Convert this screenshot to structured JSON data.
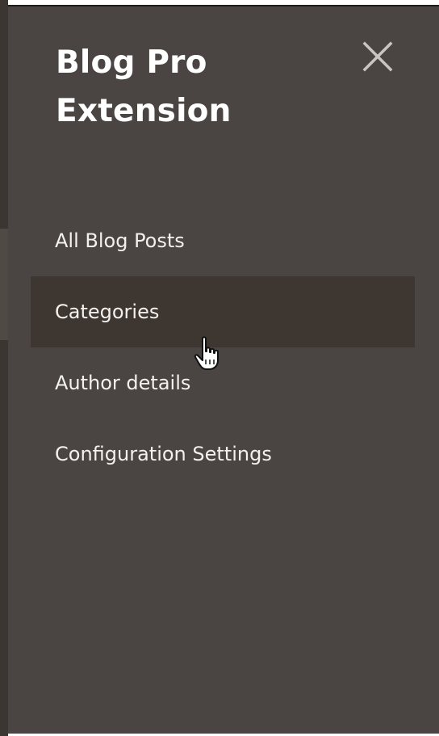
{
  "panel": {
    "title_line1": "Blog Pro",
    "title_line2": "Extension",
    "close_icon": "close-icon"
  },
  "menu": {
    "items": [
      {
        "label": "All Blog Posts",
        "active": false
      },
      {
        "label": "Categories",
        "active": true
      },
      {
        "label": "Author details",
        "active": false
      },
      {
        "label": "Configuration Settings",
        "active": false
      }
    ]
  },
  "colors": {
    "panel_bg": "#4a4542",
    "active_item_bg": "#3e3631",
    "text": "#f3f1ef"
  },
  "cursor": {
    "icon": "hand-pointer-icon"
  }
}
